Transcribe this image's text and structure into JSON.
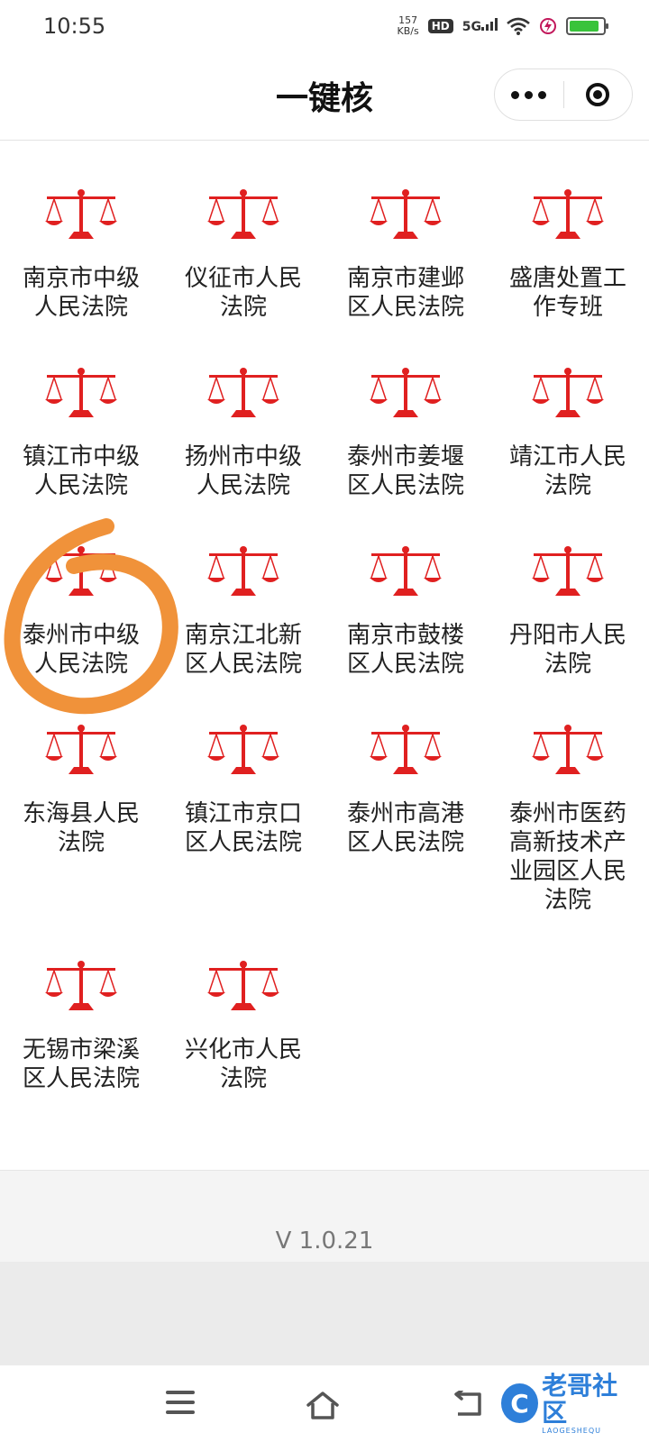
{
  "status_bar": {
    "time": "10:55",
    "net_speed_value": "157",
    "net_speed_unit": "KB/s",
    "hd": "HD",
    "network": "5G",
    "battery_level": 0.9,
    "battery_color": "#39c33b"
  },
  "nav": {
    "title": "一键核"
  },
  "courts": [
    {
      "name": "南京市中级人民法院"
    },
    {
      "name": "仪征市人民法院"
    },
    {
      "name": "南京市建邺区人民法院"
    },
    {
      "name": "盛唐处置工作专班"
    },
    {
      "name": "镇江市中级人民法院"
    },
    {
      "name": "扬州市中级人民法院"
    },
    {
      "name": "泰州市姜堰区人民法院"
    },
    {
      "name": "靖江市人民法院"
    },
    {
      "name": "泰州市中级人民法院"
    },
    {
      "name": "南京江北新区人民法院"
    },
    {
      "name": "南京市鼓楼区人民法院"
    },
    {
      "name": "丹阳市人民法院"
    },
    {
      "name": "东海县人民法院"
    },
    {
      "name": "镇江市京口区人民法院"
    },
    {
      "name": "泰州市高港区人民法院"
    },
    {
      "name": "泰州市医药高新技术产业园区人民法院"
    },
    {
      "name": "无锡市梁溪区人民法院"
    },
    {
      "name": "兴化市人民法院"
    }
  ],
  "icon": {
    "name": "scales-of-justice-icon",
    "color": "#e02020"
  },
  "footer": {
    "version": "V 1.0.21"
  },
  "watermark": {
    "badge": "C",
    "main": "老哥社区",
    "sub": "LAOGESHEQU"
  },
  "annotation_color": "#f0923a"
}
